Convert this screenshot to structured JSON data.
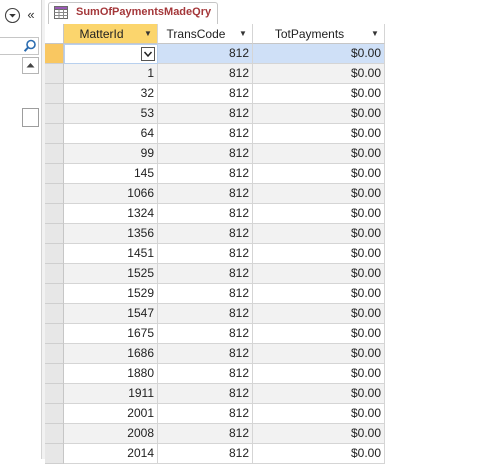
{
  "document": {
    "tab_title": "SumOfPaymentsMadeQry"
  },
  "nav": {
    "collapse_glyph": "«"
  },
  "columns": [
    {
      "name": "MatterId"
    },
    {
      "name": "TransCode"
    },
    {
      "name": "TotPayments"
    }
  ],
  "rows": [
    {
      "matter_id": "",
      "trans_code": "812",
      "tot_payments": "$0.00"
    },
    {
      "matter_id": "1",
      "trans_code": "812",
      "tot_payments": "$0.00"
    },
    {
      "matter_id": "32",
      "trans_code": "812",
      "tot_payments": "$0.00"
    },
    {
      "matter_id": "53",
      "trans_code": "812",
      "tot_payments": "$0.00"
    },
    {
      "matter_id": "64",
      "trans_code": "812",
      "tot_payments": "$0.00"
    },
    {
      "matter_id": "99",
      "trans_code": "812",
      "tot_payments": "$0.00"
    },
    {
      "matter_id": "145",
      "trans_code": "812",
      "tot_payments": "$0.00"
    },
    {
      "matter_id": "1066",
      "trans_code": "812",
      "tot_payments": "$0.00"
    },
    {
      "matter_id": "1324",
      "trans_code": "812",
      "tot_payments": "$0.00"
    },
    {
      "matter_id": "1356",
      "trans_code": "812",
      "tot_payments": "$0.00"
    },
    {
      "matter_id": "1451",
      "trans_code": "812",
      "tot_payments": "$0.00"
    },
    {
      "matter_id": "1525",
      "trans_code": "812",
      "tot_payments": "$0.00"
    },
    {
      "matter_id": "1529",
      "trans_code": "812",
      "tot_payments": "$0.00"
    },
    {
      "matter_id": "1547",
      "trans_code": "812",
      "tot_payments": "$0.00"
    },
    {
      "matter_id": "1675",
      "trans_code": "812",
      "tot_payments": "$0.00"
    },
    {
      "matter_id": "1686",
      "trans_code": "812",
      "tot_payments": "$0.00"
    },
    {
      "matter_id": "1880",
      "trans_code": "812",
      "tot_payments": "$0.00"
    },
    {
      "matter_id": "1911",
      "trans_code": "812",
      "tot_payments": "$0.00"
    },
    {
      "matter_id": "2001",
      "trans_code": "812",
      "tot_payments": "$0.00"
    },
    {
      "matter_id": "2008",
      "trans_code": "812",
      "tot_payments": "$0.00"
    },
    {
      "matter_id": "2014",
      "trans_code": "812",
      "tot_payments": "$0.00"
    }
  ],
  "current_row": 0,
  "selected_column": 0,
  "colors": {
    "tab_title": "#a4373a",
    "selected_header": "#fbd56d",
    "current_row_selector": "#f9c761",
    "current_row_highlight": "#cfe0f7",
    "alt_row": "#f2f2f2"
  },
  "icons": {
    "nav_menu": "dropdown-circle-icon",
    "nav_collapse": "double-chevron-left-icon",
    "search": "magnifier-icon",
    "scroll_up": "scroll-up-arrow-icon",
    "query_tab": "query-table-icon",
    "column_sort": "sort-arrow-icon",
    "combo_dropdown": "chevron-down-icon"
  }
}
